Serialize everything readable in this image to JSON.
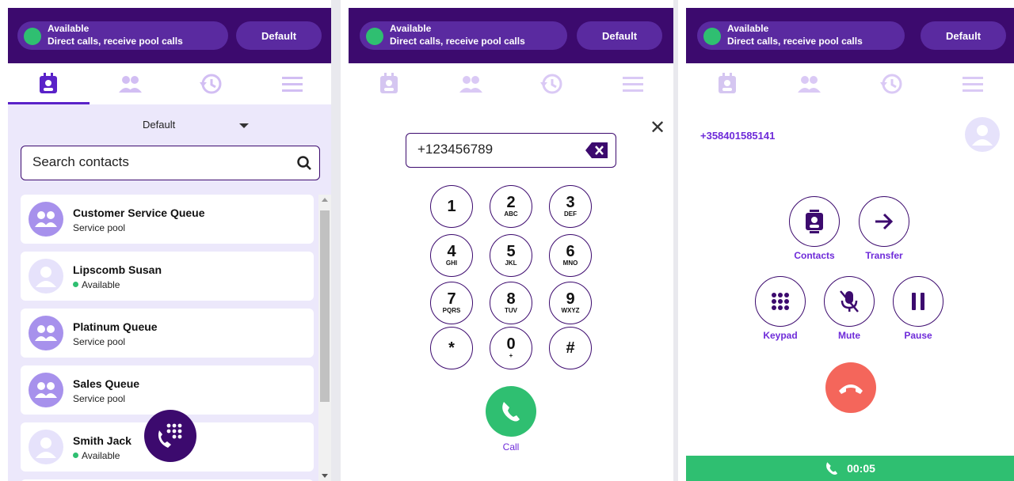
{
  "status": {
    "title": "Available",
    "subtitle": "Direct calls, receive pool calls",
    "profile_button": "Default",
    "dot_color": "#2fbf71"
  },
  "tabs": [
    {
      "icon": "contacts-card-icon"
    },
    {
      "icon": "group-icon"
    },
    {
      "icon": "history-icon"
    },
    {
      "icon": "menu-icon"
    }
  ],
  "contacts_panel": {
    "filter_value": "Default",
    "search_placeholder": "Search contacts",
    "items": [
      {
        "name": "Customer Service Queue",
        "sub": "Service pool",
        "type": "queue"
      },
      {
        "name": "Lipscomb Susan",
        "sub": "Available",
        "type": "person"
      },
      {
        "name": "Platinum Queue",
        "sub": "Service pool",
        "type": "queue"
      },
      {
        "name": "Sales Queue",
        "sub": "Service pool",
        "type": "queue"
      },
      {
        "name": "Smith Jack",
        "sub": "Available",
        "type": "person"
      }
    ]
  },
  "dialer_panel": {
    "number": "+123456789",
    "keys": [
      {
        "digit": "1",
        "letters": ""
      },
      {
        "digit": "2",
        "letters": "ABC"
      },
      {
        "digit": "3",
        "letters": "DEF"
      },
      {
        "digit": "4",
        "letters": "GHI"
      },
      {
        "digit": "5",
        "letters": "JKL"
      },
      {
        "digit": "6",
        "letters": "MNO"
      },
      {
        "digit": "7",
        "letters": "PQRS"
      },
      {
        "digit": "8",
        "letters": "TUV"
      },
      {
        "digit": "9",
        "letters": "WXYZ"
      },
      {
        "digit": "*",
        "letters": ""
      },
      {
        "digit": "0",
        "letters": "+"
      },
      {
        "digit": "#",
        "letters": ""
      }
    ],
    "call_label": "Call"
  },
  "call_panel": {
    "number": "+358401585141",
    "actions": {
      "contacts": "Contacts",
      "transfer": "Transfer",
      "keypad": "Keypad",
      "mute": "Mute",
      "pause": "Pause"
    },
    "timer": "00:05"
  },
  "colors": {
    "header": "#3c0a6e",
    "accent": "#6e2bd9",
    "green": "#2fbf71",
    "hangup": "#f4665b"
  }
}
